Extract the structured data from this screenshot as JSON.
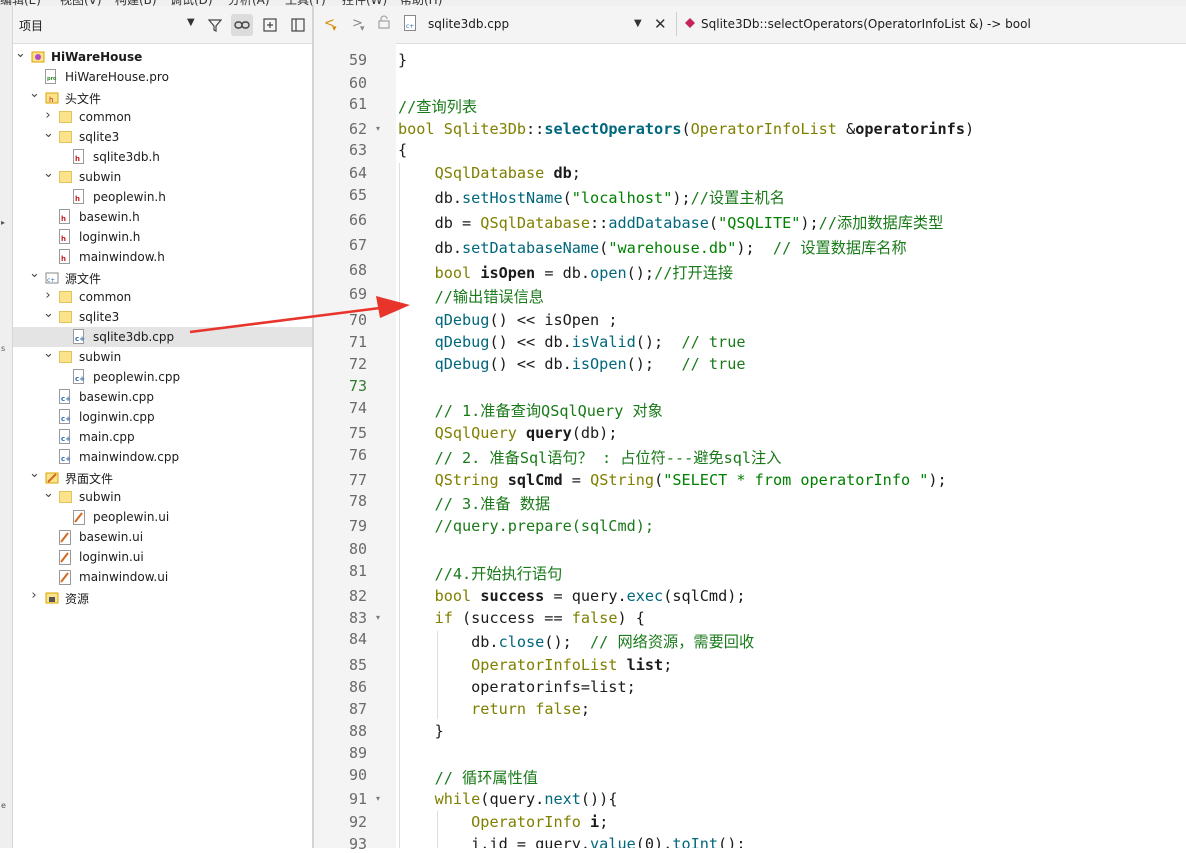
{
  "menubar": {
    "items": [
      "编辑(E)",
      "视图(V)",
      "构建(B)",
      "调试(D)",
      "分析(A)",
      "工具(T)",
      "控件(W)",
      "帮助(H)"
    ]
  },
  "project_panel": {
    "title": "项目",
    "icons": [
      "filter-icon",
      "link-icon",
      "add-split-icon",
      "close-split-icon"
    ],
    "tree": [
      {
        "label": "HiWareHouse",
        "kind": "project",
        "expanded": true,
        "bold": true
      },
      {
        "label": "HiWareHouse.pro",
        "kind": "pro"
      },
      {
        "label": "头文件",
        "kind": "group-h",
        "expanded": true
      },
      {
        "label": "common",
        "kind": "folder",
        "expanded": false
      },
      {
        "label": "sqlite3",
        "kind": "folder",
        "expanded": true
      },
      {
        "label": "sqlite3db.h",
        "kind": "h"
      },
      {
        "label": "subwin",
        "kind": "folder",
        "expanded": true
      },
      {
        "label": "peoplewin.h",
        "kind": "h"
      },
      {
        "label": "basewin.h",
        "kind": "h"
      },
      {
        "label": "loginwin.h",
        "kind": "h"
      },
      {
        "label": "mainwindow.h",
        "kind": "h"
      },
      {
        "label": "源文件",
        "kind": "group-cpp",
        "expanded": true
      },
      {
        "label": "common",
        "kind": "folder",
        "expanded": false
      },
      {
        "label": "sqlite3",
        "kind": "folder",
        "expanded": true
      },
      {
        "label": "sqlite3db.cpp",
        "kind": "cpp",
        "selected": true
      },
      {
        "label": "subwin",
        "kind": "folder",
        "expanded": true
      },
      {
        "label": "peoplewin.cpp",
        "kind": "cpp"
      },
      {
        "label": "basewin.cpp",
        "kind": "cpp"
      },
      {
        "label": "loginwin.cpp",
        "kind": "cpp"
      },
      {
        "label": "main.cpp",
        "kind": "cpp"
      },
      {
        "label": "mainwindow.cpp",
        "kind": "cpp"
      },
      {
        "label": "界面文件",
        "kind": "group-ui",
        "expanded": true
      },
      {
        "label": "subwin",
        "kind": "folder",
        "expanded": true
      },
      {
        "label": "peoplewin.ui",
        "kind": "ui"
      },
      {
        "label": "basewin.ui",
        "kind": "ui"
      },
      {
        "label": "loginwin.ui",
        "kind": "ui"
      },
      {
        "label": "mainwindow.ui",
        "kind": "ui"
      },
      {
        "label": "资源",
        "kind": "group-res",
        "expanded": false
      }
    ]
  },
  "editor": {
    "file_tab": "sqlite3db.cpp",
    "symbol": "Sqlite3Db::selectOperators(OperatorInfoList &) -> bool",
    "current_line": 73,
    "lines": [
      {
        "n": 59,
        "parts": [
          [
            "}",
            "p"
          ]
        ]
      },
      {
        "n": 60,
        "parts": []
      },
      {
        "n": 61,
        "parts": [
          [
            "//查询列表",
            "c"
          ]
        ]
      },
      {
        "n": 62,
        "fold": true,
        "parts": [
          [
            "bool",
            "t"
          ],
          [
            " ",
            "p"
          ],
          [
            "Sqlite3Db",
            "t"
          ],
          [
            "::",
            "p"
          ],
          [
            "selectOperators",
            "fb"
          ],
          [
            "(",
            "p"
          ],
          [
            "OperatorInfoList",
            "t"
          ],
          [
            " &",
            "p"
          ],
          [
            "operatorinfs",
            "vb"
          ],
          [
            ")",
            "p"
          ]
        ]
      },
      {
        "n": 63,
        "parts": [
          [
            "{",
            "p"
          ]
        ]
      },
      {
        "n": 64,
        "parts": [
          [
            "    ",
            "p"
          ],
          [
            "QSqlDatabase",
            "t"
          ],
          [
            " ",
            "p"
          ],
          [
            "db",
            "vb"
          ],
          [
            ";",
            "p"
          ]
        ]
      },
      {
        "n": 65,
        "parts": [
          [
            "    db.",
            "p"
          ],
          [
            "setHostName",
            "f"
          ],
          [
            "(",
            "p"
          ],
          [
            "\"localhost\"",
            "s"
          ],
          [
            ");",
            "p"
          ],
          [
            "//设置主机名",
            "c"
          ]
        ]
      },
      {
        "n": 66,
        "parts": [
          [
            "    db = ",
            "p"
          ],
          [
            "QSqlDatabase",
            "t"
          ],
          [
            "::",
            "p"
          ],
          [
            "addDatabase",
            "f"
          ],
          [
            "(",
            "p"
          ],
          [
            "\"QSQLITE\"",
            "s"
          ],
          [
            ");",
            "p"
          ],
          [
            "//添加数据库类型",
            "c"
          ]
        ]
      },
      {
        "n": 67,
        "parts": [
          [
            "    db.",
            "p"
          ],
          [
            "setDatabaseName",
            "f"
          ],
          [
            "(",
            "p"
          ],
          [
            "\"warehouse.db\"",
            "s"
          ],
          [
            ");  ",
            "p"
          ],
          [
            "// 设置数据库名称",
            "c"
          ]
        ]
      },
      {
        "n": 68,
        "parts": [
          [
            "    ",
            "p"
          ],
          [
            "bool",
            "t"
          ],
          [
            " ",
            "p"
          ],
          [
            "isOpen",
            "vb"
          ],
          [
            " = db.",
            "p"
          ],
          [
            "open",
            "f"
          ],
          [
            "();",
            "p"
          ],
          [
            "//打开连接",
            "c"
          ]
        ]
      },
      {
        "n": 69,
        "parts": [
          [
            "    ",
            "p"
          ],
          [
            "//输出错误信息",
            "c"
          ]
        ]
      },
      {
        "n": 70,
        "parts": [
          [
            "    ",
            "p"
          ],
          [
            "qDebug",
            "f"
          ],
          [
            "() << isOpen ;",
            "p"
          ]
        ]
      },
      {
        "n": 71,
        "parts": [
          [
            "    ",
            "p"
          ],
          [
            "qDebug",
            "f"
          ],
          [
            "() << db.",
            "p"
          ],
          [
            "isValid",
            "f"
          ],
          [
            "();  ",
            "p"
          ],
          [
            "// true",
            "c"
          ]
        ]
      },
      {
        "n": 72,
        "parts": [
          [
            "    ",
            "p"
          ],
          [
            "qDebug",
            "f"
          ],
          [
            "() << db.",
            "p"
          ],
          [
            "isOpen",
            "f"
          ],
          [
            "();   ",
            "p"
          ],
          [
            "// true",
            "c"
          ]
        ]
      },
      {
        "n": 73,
        "parts": []
      },
      {
        "n": 74,
        "parts": [
          [
            "    ",
            "p"
          ],
          [
            "// 1.准备查询QSqlQuery 对象",
            "c"
          ]
        ]
      },
      {
        "n": 75,
        "parts": [
          [
            "    ",
            "p"
          ],
          [
            "QSqlQuery",
            "t"
          ],
          [
            " ",
            "p"
          ],
          [
            "query",
            "vb"
          ],
          [
            "(db);",
            "p"
          ]
        ]
      },
      {
        "n": 76,
        "parts": [
          [
            "    ",
            "p"
          ],
          [
            "// 2. 准备Sql语句？ : 占位符---避免sql注入",
            "c"
          ]
        ]
      },
      {
        "n": 77,
        "parts": [
          [
            "    ",
            "p"
          ],
          [
            "QString",
            "t"
          ],
          [
            " ",
            "p"
          ],
          [
            "sqlCmd",
            "vb"
          ],
          [
            " = ",
            "p"
          ],
          [
            "QString",
            "t"
          ],
          [
            "(",
            "p"
          ],
          [
            "\"SELECT * from operatorInfo \"",
            "s"
          ],
          [
            ");",
            "p"
          ]
        ]
      },
      {
        "n": 78,
        "parts": [
          [
            "    ",
            "p"
          ],
          [
            "// 3.准备 数据",
            "c"
          ]
        ]
      },
      {
        "n": 79,
        "parts": [
          [
            "    ",
            "p"
          ],
          [
            "//query.prepare(sqlCmd);",
            "c"
          ]
        ]
      },
      {
        "n": 80,
        "parts": []
      },
      {
        "n": 81,
        "parts": [
          [
            "    ",
            "p"
          ],
          [
            "//4.开始执行语句",
            "c"
          ]
        ]
      },
      {
        "n": 82,
        "parts": [
          [
            "    ",
            "p"
          ],
          [
            "bool",
            "t"
          ],
          [
            " ",
            "p"
          ],
          [
            "success",
            "vb"
          ],
          [
            " = query.",
            "p"
          ],
          [
            "exec",
            "f"
          ],
          [
            "(sqlCmd);",
            "p"
          ]
        ]
      },
      {
        "n": 83,
        "fold": true,
        "parts": [
          [
            "    ",
            "p"
          ],
          [
            "if",
            "t"
          ],
          [
            " (success == ",
            "p"
          ],
          [
            "false",
            "t"
          ],
          [
            ") {",
            "p"
          ]
        ]
      },
      {
        "n": 84,
        "parts": [
          [
            "        db.",
            "p"
          ],
          [
            "close",
            "f"
          ],
          [
            "();  ",
            "p"
          ],
          [
            "// 网络资源，需要回收",
            "c"
          ]
        ]
      },
      {
        "n": 85,
        "parts": [
          [
            "        ",
            "p"
          ],
          [
            "OperatorInfoList",
            "t"
          ],
          [
            " ",
            "p"
          ],
          [
            "list",
            "vb"
          ],
          [
            ";",
            "p"
          ]
        ]
      },
      {
        "n": 86,
        "parts": [
          [
            "        operatorinfs=list;",
            "p"
          ]
        ]
      },
      {
        "n": 87,
        "parts": [
          [
            "        ",
            "p"
          ],
          [
            "return",
            "t"
          ],
          [
            " ",
            "p"
          ],
          [
            "false",
            "t"
          ],
          [
            ";",
            "p"
          ]
        ]
      },
      {
        "n": 88,
        "parts": [
          [
            "    }",
            "p"
          ]
        ]
      },
      {
        "n": 89,
        "parts": []
      },
      {
        "n": 90,
        "parts": [
          [
            "    ",
            "p"
          ],
          [
            "// 循环属性值",
            "c"
          ]
        ]
      },
      {
        "n": 91,
        "fold": true,
        "parts": [
          [
            "    ",
            "p"
          ],
          [
            "while",
            "t"
          ],
          [
            "(query.",
            "p"
          ],
          [
            "next",
            "f"
          ],
          [
            "()){",
            "p"
          ]
        ]
      },
      {
        "n": 92,
        "parts": [
          [
            "        ",
            "p"
          ],
          [
            "OperatorInfo",
            "t"
          ],
          [
            " ",
            "p"
          ],
          [
            "i",
            "vb"
          ],
          [
            ";",
            "p"
          ]
        ]
      },
      {
        "n": 93,
        "parts": [
          [
            "        i.id = query.",
            "p"
          ],
          [
            "value",
            "f"
          ],
          [
            "(0).",
            "p"
          ],
          [
            "toInt",
            "f"
          ],
          [
            "();",
            "p"
          ]
        ]
      }
    ]
  },
  "colors": {
    "type": "#7f7f00",
    "keyword": "#7f7f00",
    "function": "#00677c",
    "string": "#008000",
    "comment": "#1a7a1a",
    "plain": "#1b1b1b",
    "current_line_number": "#2f7d2f",
    "annotation_arrow": "#e8342a"
  }
}
